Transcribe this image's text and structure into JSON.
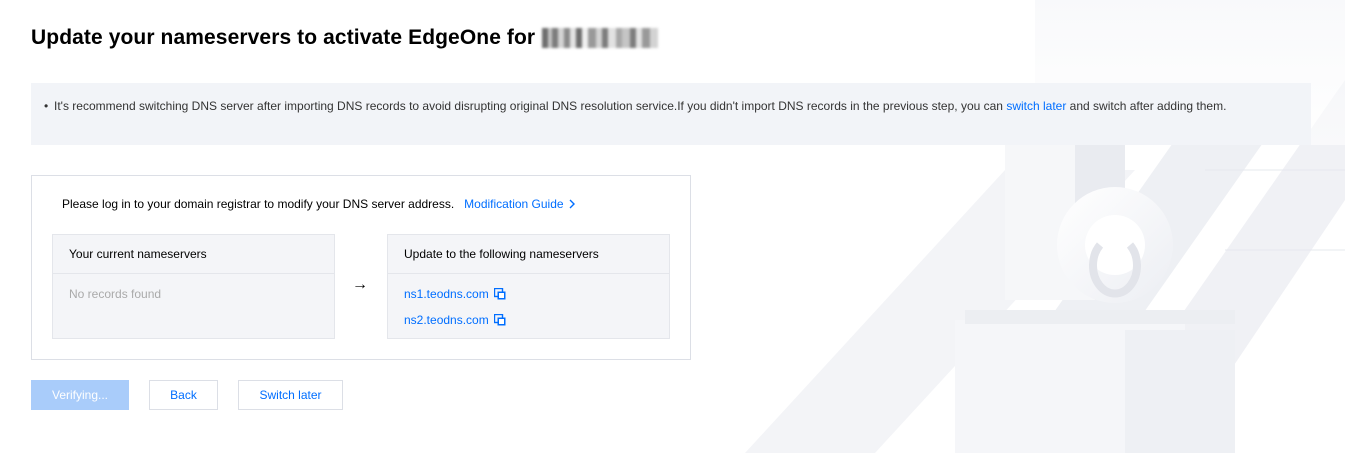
{
  "title": "Update your nameservers to activate EdgeOne for",
  "notice": {
    "text": "It's recommend switching DNS server after importing DNS records to avoid disrupting original DNS resolution service.If you didn't import DNS records in the previous step, you can ",
    "link": "switch later",
    "text_after": " and switch after adding them."
  },
  "panel": {
    "instruction": "Please log in to your domain registrar to modify your DNS server address.",
    "guide_link": "Modification Guide",
    "current": {
      "header": "Your current nameservers",
      "empty": "No records found"
    },
    "target": {
      "header": "Update to the following nameservers",
      "nameservers": [
        "ns1.teodns.com",
        "ns2.teodns.com"
      ]
    },
    "arrow": "→"
  },
  "buttons": {
    "verifying": "Verifying...",
    "back": "Back",
    "switch_later": "Switch later"
  },
  "colors": {
    "accent": "#006eff",
    "disabled_primary": "#a9ccfa",
    "notice_bg": "#f2f4f8"
  },
  "icons": {
    "bullet": "bullet-dot",
    "guide": "chevron-right-icon",
    "copy": "copy-icon"
  }
}
